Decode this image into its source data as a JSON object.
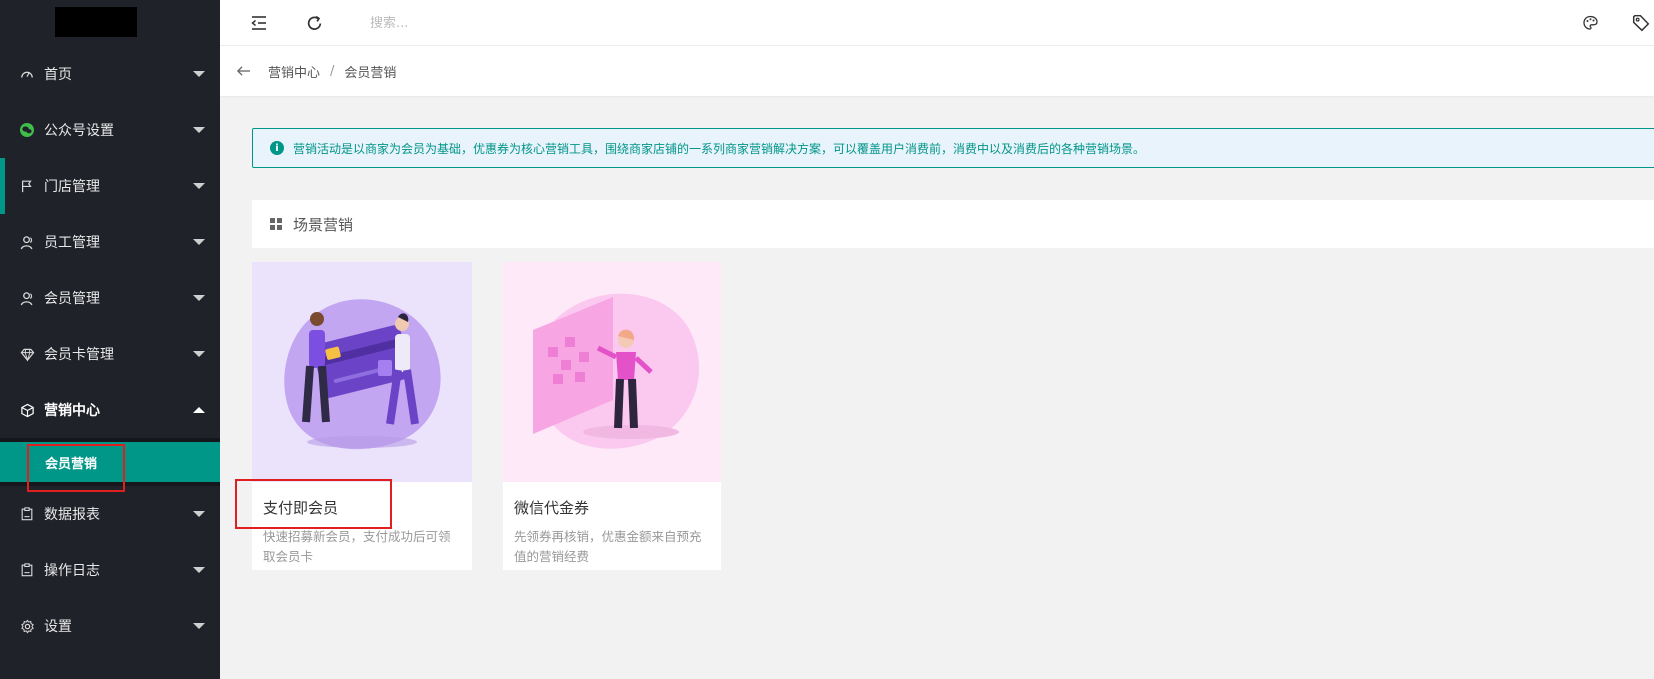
{
  "header": {
    "search_placeholder": "搜索..."
  },
  "sidebar": {
    "items": [
      {
        "label": "首页",
        "icon": "dashboard-icon"
      },
      {
        "label": "公众号设置",
        "icon": "wechat-icon"
      },
      {
        "label": "门店管理",
        "icon": "flag-icon"
      },
      {
        "label": "员工管理",
        "icon": "user-icon"
      },
      {
        "label": "会员管理",
        "icon": "user-icon"
      },
      {
        "label": "会员卡管理",
        "icon": "diamond-icon"
      },
      {
        "label": "营销中心",
        "icon": "cube-icon"
      },
      {
        "label": "数据报表",
        "icon": "clipboard-icon"
      },
      {
        "label": "操作日志",
        "icon": "clipboard-icon"
      },
      {
        "label": "设置",
        "icon": "gear-icon"
      }
    ],
    "submenu": {
      "active_label": "会员营销"
    }
  },
  "breadcrumb": {
    "parent": "营销中心",
    "separator": "/",
    "current": "会员营销"
  },
  "alert": {
    "text": "营销活动是以商家为会员为基础，优惠券为核心营销工具，围绕商家店铺的一系列商家营销解决方案，可以覆盖用户消费前，消费中以及消费后的各种营销场景。"
  },
  "section": {
    "title": "场景营销"
  },
  "cards": [
    {
      "title": "支付即会员",
      "desc": "快速招募新会员，支付成功后可领取会员卡"
    },
    {
      "title": "微信代金券",
      "desc": "先领券再核销，优惠金额来自预充值的营销经费"
    }
  ],
  "colors": {
    "sidebar_bg": "#20222a",
    "accent": "#009688",
    "highlight_box": "#e02020"
  }
}
